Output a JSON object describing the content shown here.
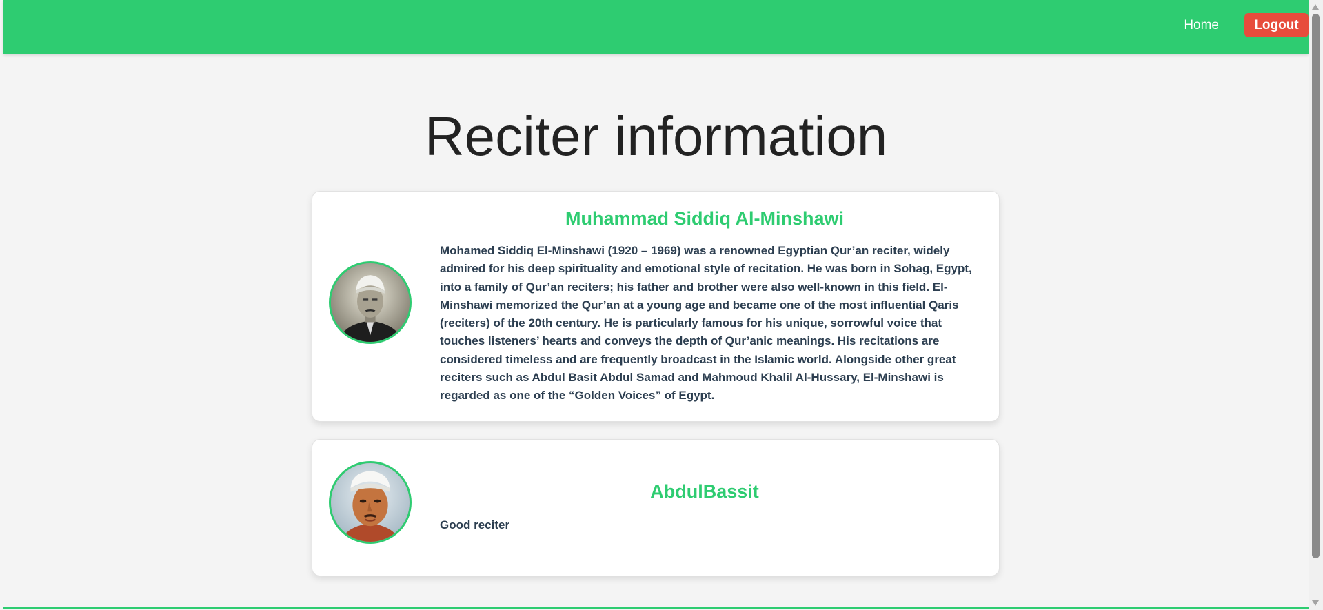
{
  "nav": {
    "home_label": "Home",
    "logout_label": "Logout"
  },
  "page": {
    "title": "Reciter information"
  },
  "reciters": [
    {
      "name": "Muhammad Siddiq Al-Minshawi",
      "bio": "Mohamed Siddiq El-Minshawi (1920 – 1969) was a renowned Egyptian Qur’an reciter, widely admired for his deep spirituality and emotional style of recitation. He was born in Sohag, Egypt, into a family of Qur’an reciters; his father and brother were also well-known in this field. El-Minshawi memorized the Qur’an at a young age and became one of the most influential Qaris (reciters) of the 20th century. He is particularly famous for his unique, sorrowful voice that touches listeners’ hearts and conveys the depth of Qur’anic meanings. His recitations are considered timeless and are frequently broadcast in the Islamic world. Alongside other great reciters such as Abdul Basit Abdul Samad and Mahmoud Khalil Al-Hussary, El-Minshawi is regarded as one of the “Golden Voices” of Egypt."
    },
    {
      "name": "AbdulBassit",
      "bio": "Good reciter"
    }
  ],
  "colors": {
    "accent": "#2ecc71",
    "logout": "#e74c3c",
    "text_dark": "#2c3e50",
    "background": "#f4f4f4"
  }
}
